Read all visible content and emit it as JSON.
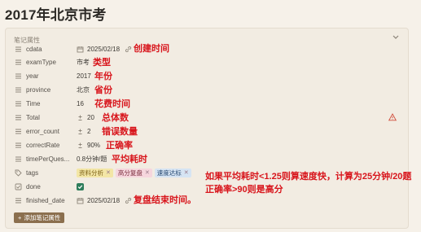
{
  "page": {
    "title": "2017年北京市考"
  },
  "panel": {
    "title": "笔记属性"
  },
  "properties": [
    {
      "name": "cdata",
      "value": "2025/02/18",
      "annotation": "创建时间"
    },
    {
      "name": "examType",
      "value": "市考",
      "annotation": "类型"
    },
    {
      "name": "year",
      "value": "2017",
      "annotation": "年份"
    },
    {
      "name": "province",
      "value": "北京",
      "annotation": "省份"
    },
    {
      "name": "Time",
      "value": "16",
      "annotation": "花费时间"
    },
    {
      "name": "Total",
      "value": "20",
      "annotation": "总体数"
    },
    {
      "name": "error_count",
      "value": "2",
      "annotation": "错误数量"
    },
    {
      "name": "correctRate",
      "value": "90%",
      "annotation": "正确率"
    },
    {
      "name": "timePerQues...",
      "value": "0.8分钟/题",
      "annotation": "平均耗时"
    },
    {
      "name": "tags"
    },
    {
      "name": "done"
    },
    {
      "name": "finished_date",
      "value": "2025/02/18",
      "annotation": "复盘结束时间。"
    }
  ],
  "tags": [
    {
      "label": "资料分析",
      "color": "#f3e6a6",
      "text": "#7a5d12"
    },
    {
      "label": "高分复盘",
      "color": "#f6d6dd",
      "text": "#7a2d3d"
    },
    {
      "label": "速度达标",
      "color": "#d6e4f3",
      "text": "#24466f"
    }
  ],
  "note": {
    "line1": "如果平均耗时<1.25则算速度快，计算为25分钟/20题",
    "line2": "正确率>90则是高分"
  },
  "done_checked": true,
  "add_button": {
    "label": "添加笔记属性"
  },
  "colors": {
    "accent": "#d8141b",
    "check": "#2e7d5b",
    "button": "#8b6f4e"
  }
}
